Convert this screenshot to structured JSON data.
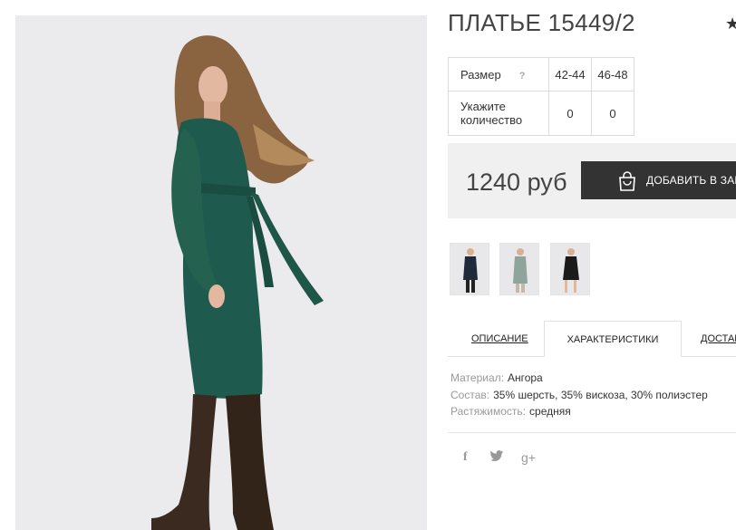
{
  "product": {
    "title": "ПЛАТЬЕ 15449/2",
    "favorite_icon": "star-icon"
  },
  "sizes_table": {
    "size_label": "Размер",
    "help_mark": "?",
    "sizes": [
      "42-44",
      "46-48"
    ],
    "quantity_label": "Укажите количество",
    "quantities": [
      "0",
      "0"
    ]
  },
  "purchase": {
    "price": "1240 руб",
    "add_button_label": "ДОБАВИТЬ В ЗАКА",
    "add_button_icon": "shopping-bag-icon"
  },
  "thumbnails": [
    {
      "alt_color": "#1f2a3a"
    },
    {
      "alt_color": "#8fa59b"
    },
    {
      "alt_color": "#1a1a1a"
    }
  ],
  "tabs": [
    {
      "label": "ОПИСАНИЕ",
      "active": false
    },
    {
      "label": "ХАРАКТЕРИСТИКИ",
      "active": true
    },
    {
      "label": "ДОСТАВ",
      "active": false
    }
  ],
  "specs": [
    {
      "key": "Материал:",
      "value": "Ангора"
    },
    {
      "key": "Состав:",
      "value": "35% шерсть, 35% вискоза, 30% полиэстер"
    },
    {
      "key": "Растяжимость:",
      "value": "средняя"
    }
  ],
  "social": {
    "facebook": "f",
    "twitter": "t",
    "googleplus": "g+"
  },
  "colors": {
    "dress": "#1f5a4e",
    "button": "#333333",
    "price_bg": "#f0f0f0"
  }
}
